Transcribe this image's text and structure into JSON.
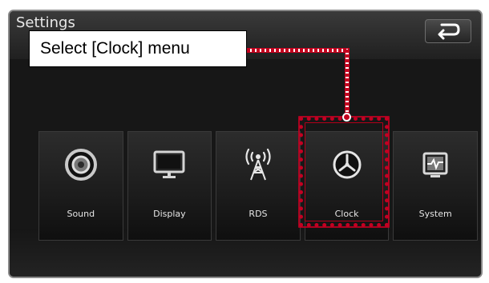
{
  "header": {
    "title": "Settings",
    "back_icon": "back-arrow-icon"
  },
  "callout": {
    "text": "Select [Clock] menu"
  },
  "menu": {
    "items": [
      {
        "label": "Sound",
        "icon": "speaker-icon"
      },
      {
        "label": "Display",
        "icon": "monitor-icon"
      },
      {
        "label": "RDS",
        "icon": "antenna-icon"
      },
      {
        "label": "Clock",
        "icon": "clock-icon"
      },
      {
        "label": "System",
        "icon": "system-icon"
      }
    ]
  },
  "colors": {
    "highlight": "#c40022",
    "tile_background": "#1c1c1c",
    "frame_border": "#8a8a8a"
  }
}
